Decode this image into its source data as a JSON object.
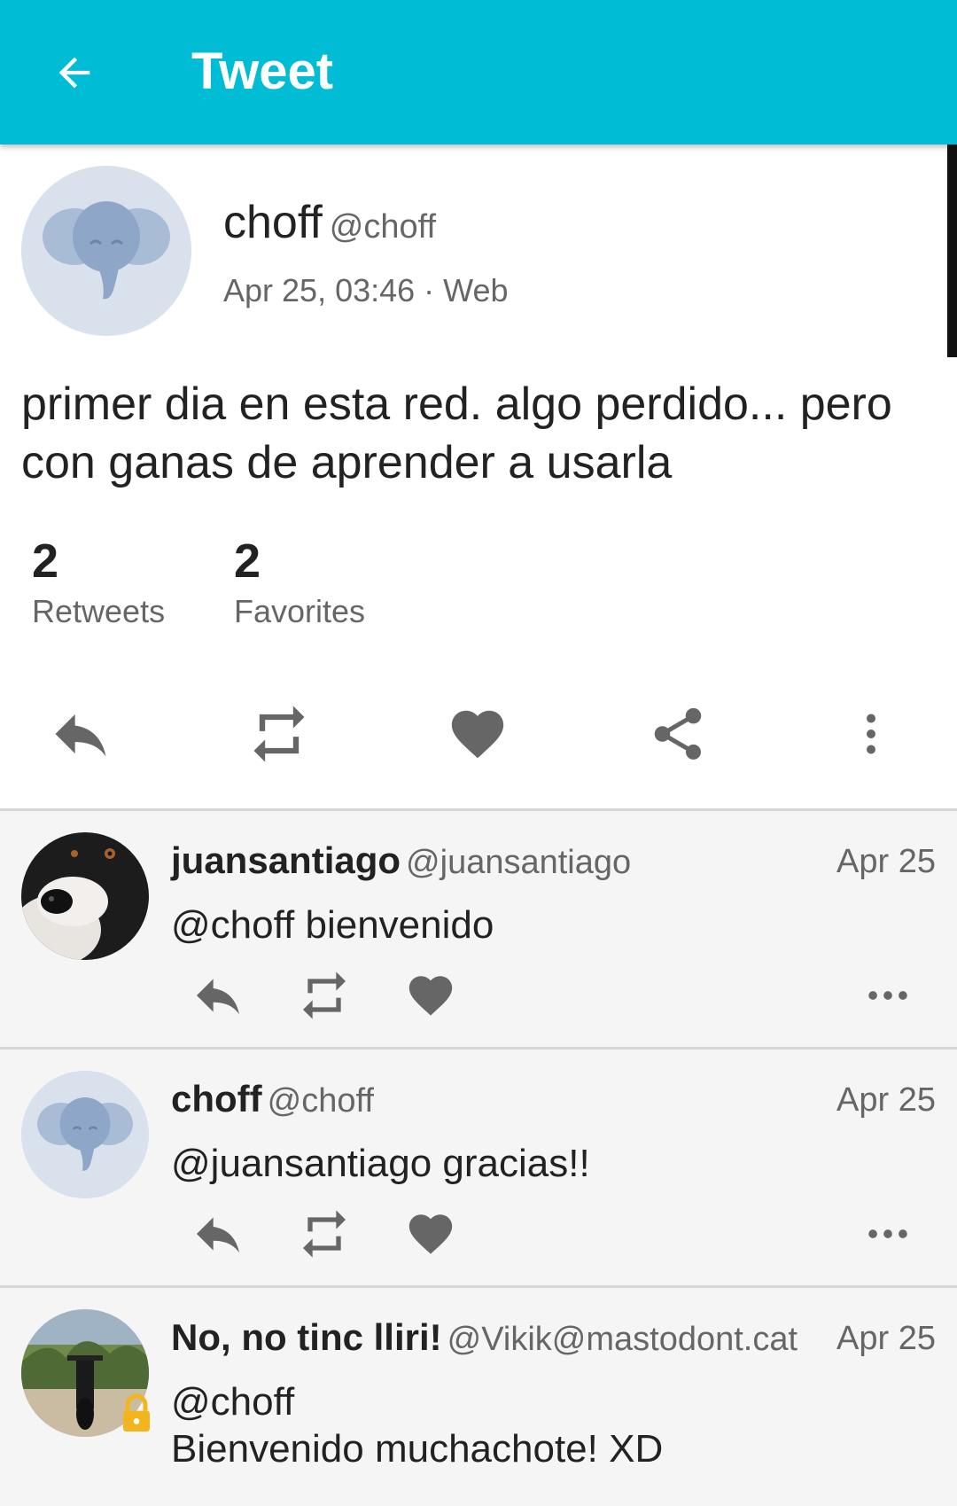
{
  "appbar": {
    "title": "Tweet",
    "color": "#00BCD4",
    "back_icon": "arrow-back-icon"
  },
  "tweet": {
    "display_name": "choff",
    "handle": "@choff",
    "meta": "Apr 25, 03:46 · Web",
    "body": "primer dia en esta red. algo perdido... pero con ganas de aprender a usarla",
    "retweets_count": "2",
    "retweets_label": "Retweets",
    "favorites_count": "2",
    "favorites_label": "Favorites",
    "actions": [
      "reply-icon",
      "boost-icon",
      "favorite-icon",
      "share-icon",
      "more-vert-icon"
    ]
  },
  "replies": [
    {
      "display_name": "juansantiago",
      "handle": "@juansantiago",
      "time": "Apr 25",
      "text": "@choff bienvenido",
      "avatar": "dog-photo"
    },
    {
      "display_name": "choff",
      "handle": "@choff",
      "time": "Apr 25",
      "text": "@juansantiago gracias!!",
      "avatar": "default-elephant"
    },
    {
      "display_name": "No, no tinc lliri!",
      "handle": "@Vikik@mastodont.cat",
      "time": "Apr 25",
      "text_line1": "@choff",
      "text_line2": "Bienvenido muchachote! XD",
      "avatar": "motorbike-photo",
      "locked": true
    }
  ]
}
